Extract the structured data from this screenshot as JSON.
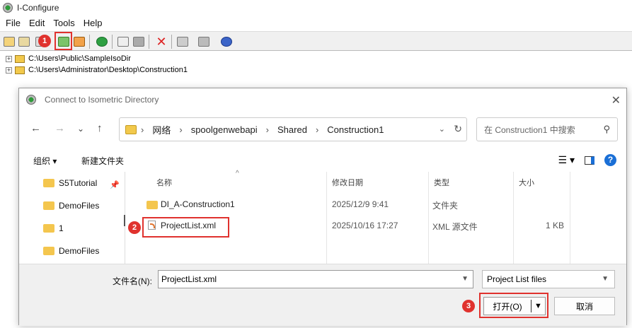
{
  "app": {
    "title": "I-Configure",
    "menu": [
      "File",
      "Edit",
      "Tools",
      "Help"
    ],
    "toolbar_icons": [
      "open-folder-icon",
      "save-folder-icon",
      "list-icon",
      "connect-directory-icon",
      "disconnect-icon",
      "check-icon",
      "copy-icon",
      "paste-icon",
      "delete-icon",
      "properties-icon",
      "comment-icon",
      "help-icon"
    ]
  },
  "tree": {
    "items": [
      {
        "expander": "+",
        "label": "C:\\Users\\Public\\SampleIsoDir"
      },
      {
        "expander": "+",
        "label": "C:\\Users\\Administrator\\Desktop\\Construction1"
      }
    ]
  },
  "dialog": {
    "title": "Connect to Isometric Directory",
    "close": "✕",
    "nav": {
      "back": "←",
      "forward": "→",
      "recent": "⌄",
      "up": "↑"
    },
    "address": {
      "segments": [
        "网络",
        "spoolgenwebapi",
        "Shared",
        "Construction1"
      ],
      "separator": "›"
    },
    "search_placeholder": "在 Construction1 中搜索",
    "commands": {
      "organize": "组织 ▾",
      "new_folder": "新建文件夹"
    },
    "sidebar": [
      {
        "label": "S5Tutorial",
        "pinned": true
      },
      {
        "label": "DemoFiles"
      },
      {
        "label": "1"
      },
      {
        "label": "DemoFiles"
      }
    ],
    "columns": {
      "name": "名称",
      "modified": "修改日期",
      "type": "类型",
      "size": "大小"
    },
    "files": [
      {
        "name": "DI_A-Construction1",
        "modified": "2025/12/9 9:41",
        "type": "文件夹",
        "size": "",
        "kind": "folder"
      },
      {
        "name": "ProjectList.xml",
        "modified": "2025/10/16 17:27",
        "type": "XML 源文件",
        "size": "1 KB",
        "kind": "xml"
      }
    ],
    "filename_label": "文件名(N):",
    "filename_value": "ProjectList.xml",
    "filetype_value": "Project List files",
    "open_label": "打开(O)",
    "cancel_label": "取消"
  },
  "callouts": {
    "c1": "1",
    "c2": "2",
    "c3": "3"
  },
  "colors": {
    "callout": "#e0322e",
    "folder": "#f4c64e",
    "help": "#1a6fd6"
  }
}
